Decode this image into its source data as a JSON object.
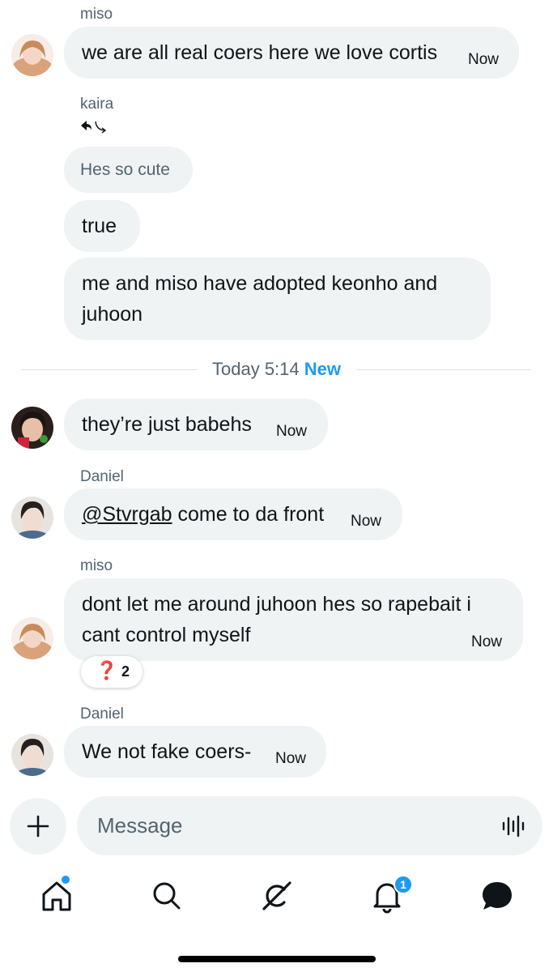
{
  "messages": [
    {
      "sender": "miso",
      "text": "we are all real coers here we love cortis",
      "time": "Now"
    },
    {
      "sender": "kaira",
      "reply_quote": "Hes so cute"
    },
    {
      "text": "true"
    },
    {
      "text_line1": "me and miso have adopted keonho and",
      "text_line2": "juhoon"
    },
    {
      "text": "they’re just babehs",
      "time": "Now"
    },
    {
      "sender": "Daniel",
      "mention": "@Stvrgab",
      "text": " come to da front",
      "time": "Now"
    },
    {
      "sender": "miso",
      "text_line1": "dont let me around juhoon hes so rapebait i",
      "text_line2": "cant control myself",
      "time": "Now",
      "reaction": {
        "emoji": "❓",
        "count": "2"
      }
    },
    {
      "sender": "Daniel",
      "text": "We not fake coers-",
      "time": "Now"
    }
  ],
  "divider": {
    "label": "Today 5:14",
    "new_label": "New"
  },
  "composer": {
    "placeholder": "Message"
  },
  "nav": {
    "items": [
      "home-icon",
      "search-icon",
      "grok-icon",
      "notifications-icon",
      "messages-icon"
    ],
    "notification_count": "1"
  },
  "colors": {
    "accent": "#1d9bf0",
    "bubble": "#eff3f4",
    "muted_text": "#536471"
  }
}
